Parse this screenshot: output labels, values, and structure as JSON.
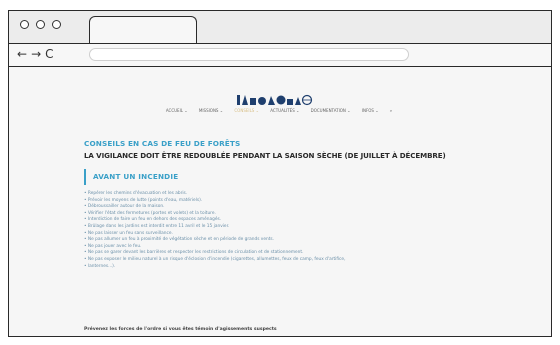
{
  "browser": {
    "nav_buttons": [
      "←",
      "→",
      "C"
    ]
  },
  "page": {
    "menu_items": [
      "ACCUEIL ⌄",
      "MISSIONS ⌄",
      "CONSEILS ⌄",
      "ACTUALITÉS ⌄",
      "DOCUMENTATION ⌄",
      "INFOS ⌄"
    ],
    "kicker": "CONSEILS EN CAS DE FEU DE FORÊTS",
    "headline": "LA VIGILANCE DOIT ÊTRE REDOUBLÉE PENDANT LA SAISON SÈCHE (DE JUILLET À DÉCEMBRE)",
    "section_title": "AVANT UN INCENDIE",
    "bullets": [
      "Repérer les chemins d'évacuation et les abris.",
      "Prévoir les moyens de lutte (points d'eau, matériels).",
      "Débroussailler autour de la maison.",
      "Vérifier l'état des fermetures (portes et volets) et la toiture.",
      "Interdiction de faire un feu en dehors des espaces aménagés.",
      "Brûlage dans les jardins est interdit entre 11 avril et le 15 janvier.",
      "Ne pas laisser un feu sans surveillance.",
      "Ne pas allumer un feu à proximité de végétation sèche et en période de grands vents.",
      "Ne pas jouer avec le feu.",
      "Ne pas se garer devant les barrières et respecter les restrictions de circulation et de stationnement.",
      "Ne pas exposer le milieu naturel à un risque d'éclosion d'incendie (cigarettes, allumettes, feux de camp, feux d'artifice,",
      "lanternes...)."
    ],
    "footnote": "Prévenez les forces de l'ordre si vous êtes témoin d'agissements suspects"
  },
  "colors": {
    "accent": "#3aa0c8",
    "text": "#2a2a2a",
    "list_text": "#6a8fa8",
    "menu_active": "#d9c089"
  }
}
